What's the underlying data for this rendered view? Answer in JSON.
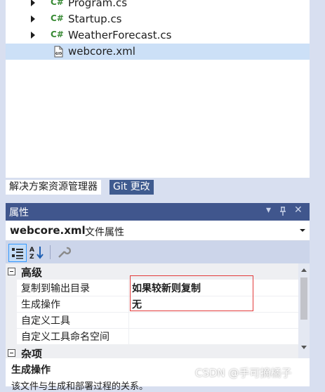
{
  "solution_explorer": {
    "items": [
      {
        "label": "Program.cs",
        "icon": "csharp-file-icon",
        "expandable": true
      },
      {
        "label": "Startup.cs",
        "icon": "csharp-file-icon",
        "expandable": true
      },
      {
        "label": "WeatherForecast.cs",
        "icon": "csharp-file-icon",
        "expandable": true
      },
      {
        "label": "webcore.xml",
        "icon": "xml-file-icon",
        "expandable": false,
        "selected": true
      }
    ],
    "cs_icon_text": "C#"
  },
  "tabs": [
    {
      "label": "解决方案资源管理器",
      "active": true
    },
    {
      "label": "Git 更改",
      "active": false
    }
  ],
  "properties": {
    "title": "属性",
    "title_buttons": {
      "dropdown": "▾",
      "pin": "📌",
      "close": "✕"
    },
    "object_name": "webcore.xml",
    "object_type": "文件属性",
    "category": "高级",
    "rows": [
      {
        "name": "复制到输出目录",
        "value": "如果较新则复制"
      },
      {
        "name": "生成操作",
        "value": "无"
      },
      {
        "name": "自定义工具",
        "value": ""
      },
      {
        "name": "自定义工具命名空间",
        "value": ""
      }
    ],
    "category2": "杂项",
    "description_title": "生成操作",
    "description_text": "该文件与生成和部署过程的关系。"
  },
  "watermark": "CSDN @手可摘橘子",
  "colors": {
    "title_bar": "#40568d",
    "selection": "#cce0f7",
    "highlight_border": "#e23a3a",
    "cs_icon": "#388a34"
  }
}
